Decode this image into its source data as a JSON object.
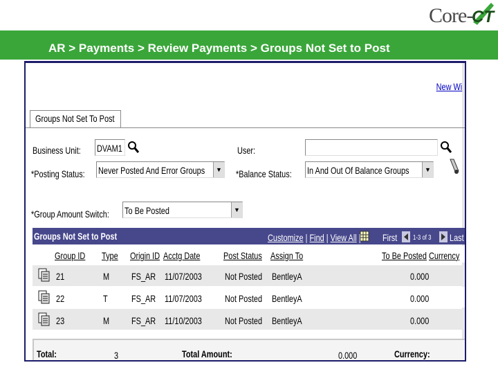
{
  "brand": {
    "core": "Core-",
    "ct": "CT"
  },
  "breadcrumb": "AR > Payments > Review Payments > Groups Not Set to Post",
  "new_window": "New Wi",
  "tab_label": "Groups Not Set To Post",
  "form": {
    "business_unit_label": "Business Unit:",
    "business_unit_value": "DVAM1",
    "user_label": "User:",
    "user_value": "",
    "posting_status_label": "*Posting Status:",
    "posting_status_value": "Never Posted And Error Groups",
    "balance_status_label": "*Balance Status:",
    "balance_status_value": "In And Out Of Balance Groups",
    "group_amount_label": "*Group Amount Switch:",
    "group_amount_value": "To Be Posted"
  },
  "grid": {
    "title": "Groups Not Set to Post",
    "customize": "Customize",
    "find": "Find",
    "view_all": "View All",
    "first": "First",
    "range": "1-3 of 3",
    "last": "Last",
    "columns": [
      "Group ID",
      "Type",
      "Origin ID",
      "Acctg Date",
      "Post Status",
      "Assign To",
      "To Be Posted",
      "Currency"
    ],
    "rows": [
      {
        "group_id": "21",
        "type": "M",
        "origin": "FS_AR",
        "date": "11/07/2003",
        "status": "Not Posted",
        "assign": "BentleyA",
        "amount": "0.000"
      },
      {
        "group_id": "22",
        "type": "T",
        "origin": "FS_AR",
        "date": "11/07/2003",
        "status": "Not Posted",
        "assign": "BentleyA",
        "amount": "0.000"
      },
      {
        "group_id": "23",
        "type": "M",
        "origin": "FS_AR",
        "date": "11/10/2003",
        "status": "Not Posted",
        "assign": "BentleyA",
        "amount": "0.000"
      }
    ]
  },
  "totals": {
    "total_label": "Total:",
    "total_value": "3",
    "amount_label": "Total Amount:",
    "amount_value": "0.000",
    "currency_label": "Currency:"
  },
  "colors": {
    "banner": "#3aa63a",
    "grid_header": "#47478c",
    "frame": "#1c1c6a",
    "brand_green": "#3aa63a"
  }
}
